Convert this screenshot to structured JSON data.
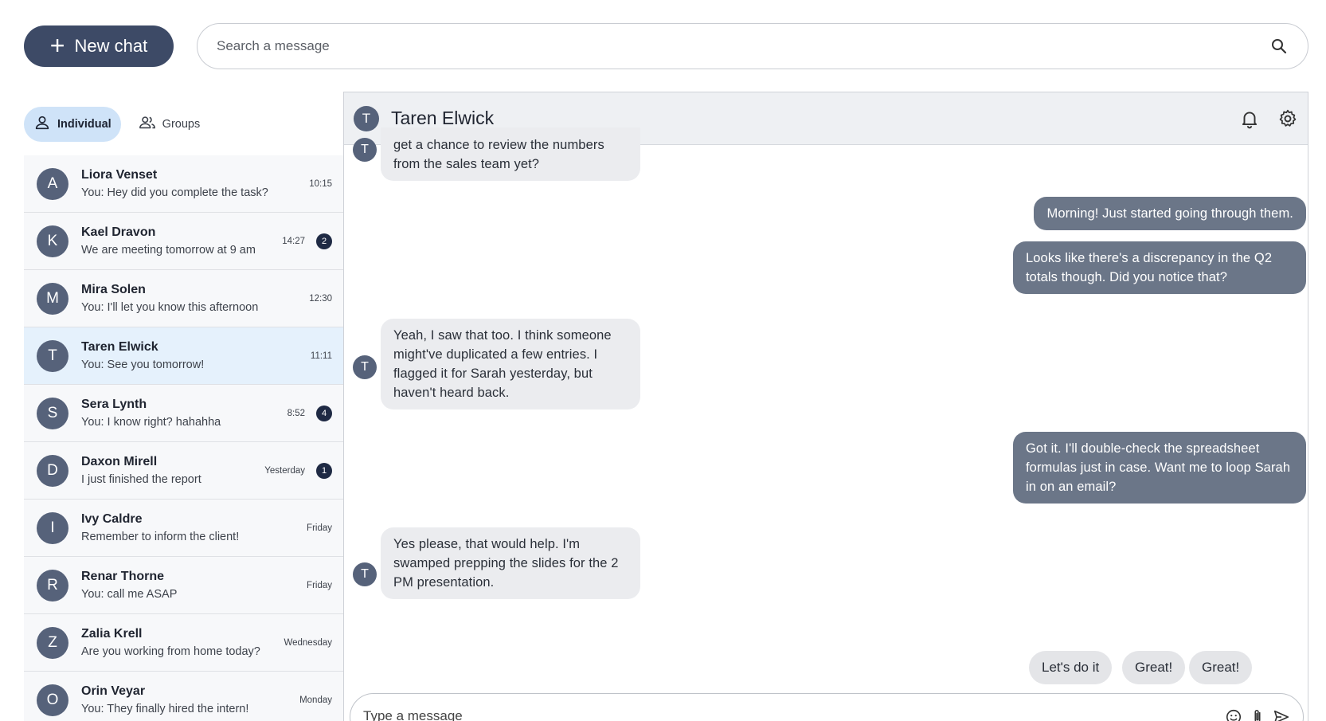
{
  "top": {
    "new_chat_label": "New chat",
    "search_placeholder": "Search a message"
  },
  "tabs": [
    {
      "label": "Individual",
      "active": true,
      "icon": "person-icon"
    },
    {
      "label": "Groups",
      "active": false,
      "icon": "group-icon"
    }
  ],
  "conversations": [
    {
      "initial": "A",
      "name": "Liora Venset",
      "preview": "You: Hey did you complete the task?",
      "time": "10:15",
      "badge": ""
    },
    {
      "initial": "K",
      "name": "Kael Dravon",
      "preview": "We are meeting tomorrow at 9 am",
      "time": "14:27",
      "badge": "2"
    },
    {
      "initial": "M",
      "name": "Mira Solen",
      "preview": "You: I'll let you know this afternoon",
      "time": "12:30",
      "badge": ""
    },
    {
      "initial": "T",
      "name": "Taren Elwick",
      "preview": "You: See you tomorrow!",
      "time": "11:11",
      "badge": "",
      "selected": true
    },
    {
      "initial": "S",
      "name": "Sera Lynth",
      "preview": "You: I know right? hahahha",
      "time": "8:52",
      "badge": "4"
    },
    {
      "initial": "D",
      "name": "Daxon Mirell",
      "preview": "I just finished the report",
      "time": "Yesterday",
      "badge": "1"
    },
    {
      "initial": "I",
      "name": "Ivy Caldre",
      "preview": "Remember to inform the client!",
      "time": "Friday",
      "badge": ""
    },
    {
      "initial": "R",
      "name": "Renar Thorne",
      "preview": "You: call me ASAP",
      "time": "Friday",
      "badge": ""
    },
    {
      "initial": "Z",
      "name": "Zalia Krell",
      "preview": "Are you working from home today?",
      "time": "Wednesday",
      "badge": ""
    },
    {
      "initial": "O",
      "name": "Orin Veyar",
      "preview": "You: They finally hired the intern!",
      "time": "Monday",
      "badge": ""
    }
  ],
  "chat": {
    "contact_initial": "T",
    "contact_name": "Taren Elwick",
    "messages": [
      {
        "from": "them",
        "text": "get a chance to review the numbers from the sales team yet?"
      },
      {
        "from": "me",
        "text": "Morning! Just started going through them."
      },
      {
        "from": "me",
        "text": "Looks like there's a discrepancy in the Q2 totals though. Did you notice that?"
      },
      {
        "from": "them",
        "text": "Yeah, I saw that too. I think someone might've duplicated a few entries. I flagged it for Sarah yesterday, but haven't heard back."
      },
      {
        "from": "me",
        "text": "Got it. I'll double-check the spreadsheet formulas just in case. Want me to loop Sarah in on an email?"
      },
      {
        "from": "them",
        "text": "Yes please, that would help. I'm swamped prepping the slides for the 2 PM presentation."
      }
    ],
    "quick_replies": [
      "Let's do it",
      "Great!",
      "Great!"
    ],
    "composer_placeholder": "Type a message"
  },
  "colors": {
    "accent": "#3d4a66",
    "selected_row": "#e5f1fc",
    "outgoing_bubble": "#6b7688",
    "incoming_bubble": "#ebecef"
  }
}
